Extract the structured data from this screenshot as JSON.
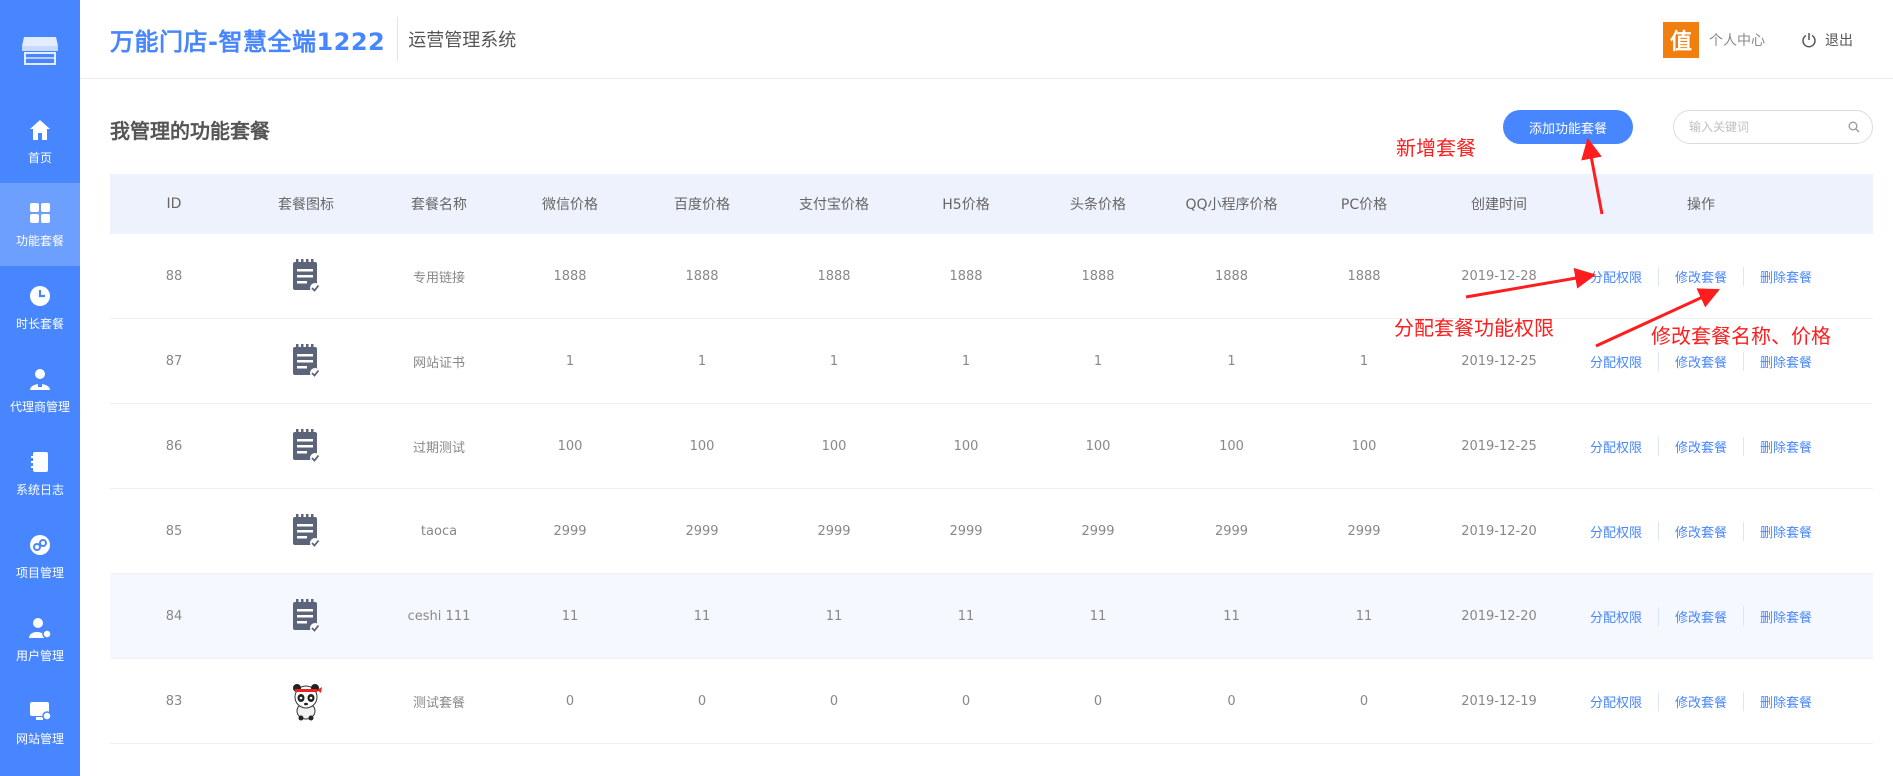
{
  "header": {
    "brand": "万能门店-智慧全端1222",
    "subtitle": "运营管理系统",
    "avatar_char": "值",
    "user_center": "个人中心",
    "logout": "退出"
  },
  "sidebar": {
    "items": [
      {
        "label": "首页",
        "icon": "home-icon"
      },
      {
        "label": "功能套餐",
        "icon": "grid-icon",
        "active": true
      },
      {
        "label": "时长套餐",
        "icon": "clock-icon"
      },
      {
        "label": "代理商管理",
        "icon": "agent-icon"
      },
      {
        "label": "系统日志",
        "icon": "log-icon"
      },
      {
        "label": "项目管理",
        "icon": "project-icon"
      },
      {
        "label": "用户管理",
        "icon": "user-settings-icon"
      },
      {
        "label": "网站管理",
        "icon": "website-icon"
      }
    ]
  },
  "main": {
    "title": "我管理的功能套餐",
    "add_button": "添加功能套餐",
    "search_placeholder": "输入关键词"
  },
  "table": {
    "headers": [
      "ID",
      "套餐图标",
      "套餐名称",
      "微信价格",
      "百度价格",
      "支付宝价格",
      "H5价格",
      "头条价格",
      "QQ小程序价格",
      "PC价格",
      "创建时间",
      "操作"
    ],
    "ops": [
      "分配权限",
      "修改套餐",
      "删除套餐"
    ],
    "rows": [
      {
        "id": "88",
        "icon": "notepad-icon",
        "name": "专用链接",
        "prices": [
          "1888",
          "1888",
          "1888",
          "1888",
          "1888",
          "1888",
          "1888"
        ],
        "created": "2019-12-28"
      },
      {
        "id": "87",
        "icon": "notepad-icon",
        "name": "网站证书",
        "prices": [
          "1",
          "1",
          "1",
          "1",
          "1",
          "1",
          "1"
        ],
        "created": "2019-12-25"
      },
      {
        "id": "86",
        "icon": "notepad-icon",
        "name": "过期测试",
        "prices": [
          "100",
          "100",
          "100",
          "100",
          "100",
          "100",
          "100"
        ],
        "created": "2019-12-25"
      },
      {
        "id": "85",
        "icon": "notepad-icon",
        "name": "taoca",
        "prices": [
          "2999",
          "2999",
          "2999",
          "2999",
          "2999",
          "2999",
          "2999"
        ],
        "created": "2019-12-20"
      },
      {
        "id": "84",
        "icon": "notepad-icon",
        "name": "ceshi 111",
        "prices": [
          "11",
          "11",
          "11",
          "11",
          "11",
          "11",
          "11"
        ],
        "created": "2019-12-20",
        "highlight": true
      },
      {
        "id": "83",
        "icon": "panda-icon",
        "name": "测试套餐",
        "prices": [
          "0",
          "0",
          "0",
          "0",
          "0",
          "0",
          "0"
        ],
        "created": "2019-12-19"
      }
    ]
  },
  "annotations": {
    "add_package": "新增套餐",
    "assign_permissions": "分配套餐功能权限",
    "edit_name_price": "修改套餐名称、价格",
    "color": "#ff1d1d"
  }
}
